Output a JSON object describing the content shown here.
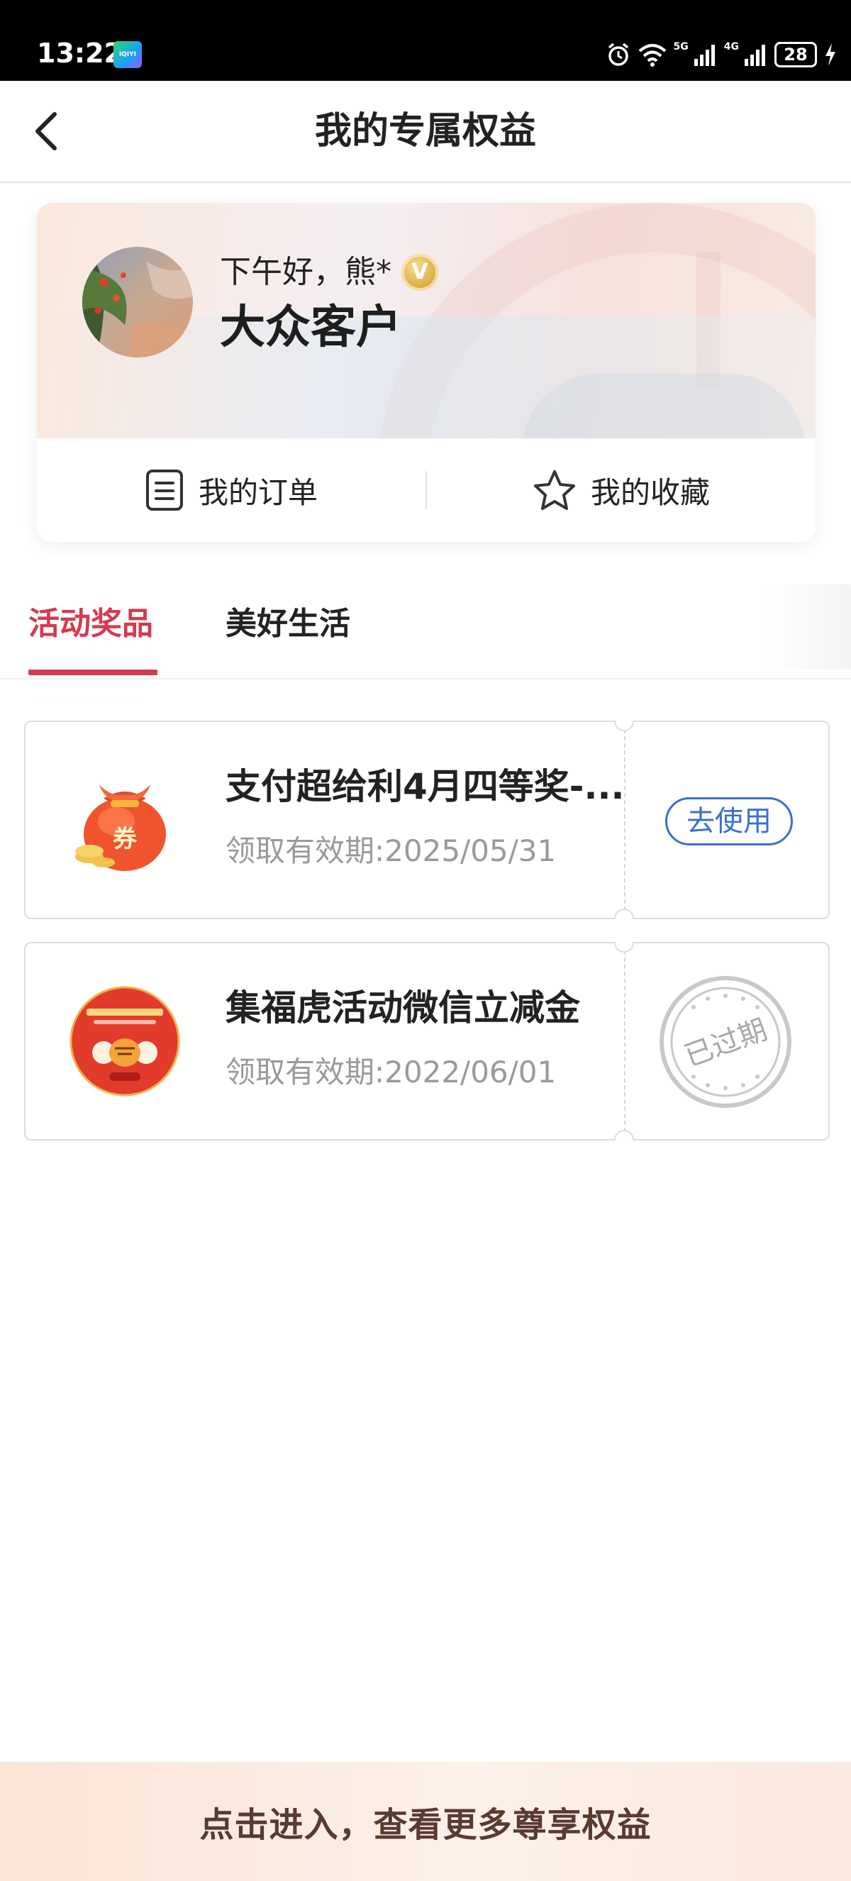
{
  "status_bar": {
    "time": "13:22",
    "app_badge_text": "iQIYI",
    "network_1": "5G",
    "network_2": "4G",
    "battery": "28"
  },
  "header": {
    "title": "我的专属权益"
  },
  "profile": {
    "greeting": "下午好，熊*",
    "vip_badge": "V",
    "tier": "大众客户",
    "actions": [
      {
        "label": "我的订单",
        "icon": "order-list-icon"
      },
      {
        "label": "我的收藏",
        "icon": "star-icon"
      }
    ]
  },
  "tabs": [
    {
      "label": "活动奖品",
      "active": true
    },
    {
      "label": "美好生活",
      "active": false
    }
  ],
  "coupons": [
    {
      "title": "支付超给利4月四等奖-...",
      "validity": "领取有效期:2025/05/31",
      "thumb_text": "券",
      "action_label": "去使用",
      "status": "active"
    },
    {
      "title": "集福虎活动微信立减金",
      "validity": "领取有效期:2022/06/01",
      "stamp_text": "已过期",
      "status": "expired"
    }
  ],
  "bottom_banner": {
    "text": "点击进入，查看更多尊享权益"
  },
  "colors": {
    "accent_red": "#d23b4f",
    "link_blue": "#3a6fd0",
    "muted_text": "#9a9a9a"
  }
}
